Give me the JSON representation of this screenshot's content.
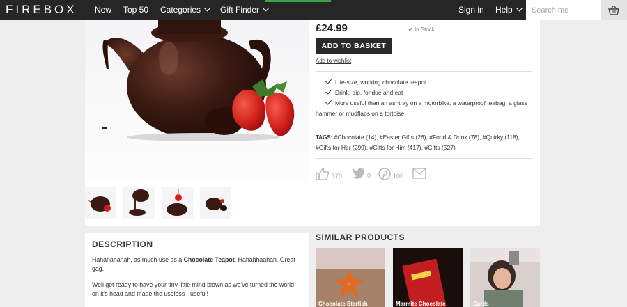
{
  "header": {
    "logo": "FIREBOX",
    "nav": [
      {
        "label": "New"
      },
      {
        "label": "Top 50"
      },
      {
        "label": "Categories"
      },
      {
        "label": "Gift Finder"
      }
    ],
    "signin": "Sign in",
    "help": "Help",
    "search_placeholder": "Search me"
  },
  "product": {
    "price": "£24.99",
    "stock": "In Stock",
    "add_to_basket": "ADD TO BASKET",
    "wishlist": "Add to wishlist",
    "features": [
      "Life-size, working chocolate teapot",
      "Drink, dip, fondue and eat",
      "More useful than an ashtray on a motorbike, a waterproof teabag, a glass hammer or mudflaps on a tortoise"
    ],
    "tags_label": "TAGS:",
    "tags": [
      "#Chocolate (14)",
      "#Easter Gifts (26)",
      "#Food & Drink (78)",
      "#Quirky (118)",
      "#Gifts for Her (299)",
      "#Gifts for Him (417)",
      "#Gifts (527)"
    ],
    "social": {
      "likes": "370",
      "tweets": "0",
      "pins": "100"
    }
  },
  "description": {
    "title": "DESCRIPTION",
    "p1_before": "Hahahahahah, as much use as a ",
    "p1_bold": "Chocolate Teapot",
    "p1_after": ". Hahahhaahah. Great gag.",
    "p2": "Well get ready to have your tiny little mind blown as we've turned the world on it's head and made the useless - useful!"
  },
  "similar": {
    "title": "SIMILAR PRODUCTS",
    "items": [
      {
        "label": "Chocolate Starfish"
      },
      {
        "label": "Marmite Chocolate"
      },
      {
        "label": "Cards"
      }
    ]
  },
  "colors": {
    "nav_bg": "#262626",
    "accent_green": "#3aa34a",
    "button_bg": "#2a2a2a"
  }
}
